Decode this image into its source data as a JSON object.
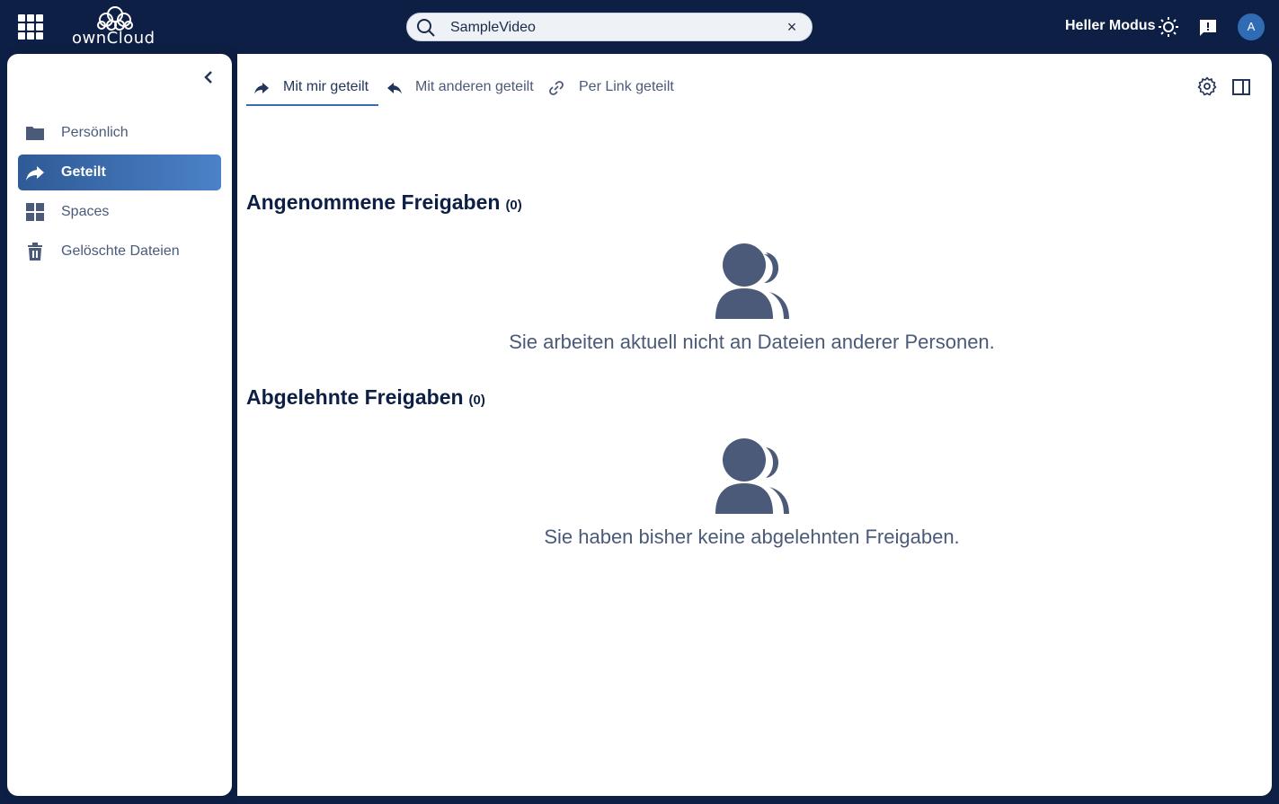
{
  "topbar": {
    "logo_text": "ownCloud",
    "search_value": "SampleVideo",
    "mode_label": "Heller Modus",
    "avatar_initial": "A"
  },
  "sidebar": {
    "items": [
      {
        "label": "Persönlich",
        "icon": "folder-icon"
      },
      {
        "label": "Geteilt",
        "icon": "share-icon",
        "active": true
      },
      {
        "label": "Spaces",
        "icon": "spaces-grid-icon"
      },
      {
        "label": "Gelöschte Dateien",
        "icon": "trash-icon"
      }
    ]
  },
  "tabs": [
    {
      "label": "Mit mir geteilt",
      "icon": "share-forward-icon",
      "active": true
    },
    {
      "label": "Mit anderen geteilt",
      "icon": "share-reply-icon"
    },
    {
      "label": "Per Link geteilt",
      "icon": "link-icon"
    }
  ],
  "sections": [
    {
      "title": "Angenommene Freigaben",
      "count": "(0)",
      "empty_message": "Sie arbeiten aktuell nicht an Dateien anderer Personen."
    },
    {
      "title": "Abgelehnte Freigaben",
      "count": "(0)",
      "empty_message": "Sie haben bisher keine abgelehnten Freigaben."
    }
  ],
  "colors": {
    "topbar_bg": "#0d1f44",
    "active_nav_start": "#2f5a96",
    "active_nav_end": "#4b82c8",
    "icon_gray": "#4a5a78",
    "avatar_bg": "#2f6cb5"
  }
}
